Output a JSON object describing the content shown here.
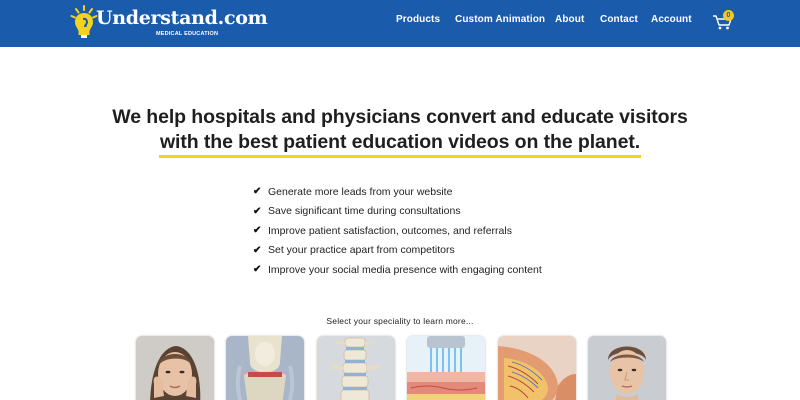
{
  "brand": {
    "name": "Understand.com",
    "tagline": "MEDICAL EDUCATION",
    "primary_color": "#1a5bab",
    "accent_color": "#f4d21f"
  },
  "nav": {
    "items": [
      {
        "label": "Products"
      },
      {
        "label": "Custom Animation"
      },
      {
        "label": "About"
      },
      {
        "label": "Contact"
      },
      {
        "label": "Account"
      }
    ],
    "cart_count": "0",
    "cart_icon": "shopping-cart-icon"
  },
  "hero": {
    "line1": "We help hospitals and physicians convert and educate visitors",
    "line2": "with the best patient education videos on the planet."
  },
  "benefits": [
    "Generate more leads from your website",
    "Save significant time during consultations",
    "Improve patient satisfaction, outcomes, and referrals",
    "Set your practice apart from competitors",
    "Improve your social media presence with engaging content"
  ],
  "specialty_prompt": "Select your speciality to learn more...",
  "specialties": [
    {
      "icon": "woman-face-image"
    },
    {
      "icon": "knee-joint-image"
    },
    {
      "icon": "spine-image"
    },
    {
      "icon": "skin-treatment-image"
    },
    {
      "icon": "breast-anatomy-image"
    },
    {
      "icon": "man-face-image"
    }
  ]
}
